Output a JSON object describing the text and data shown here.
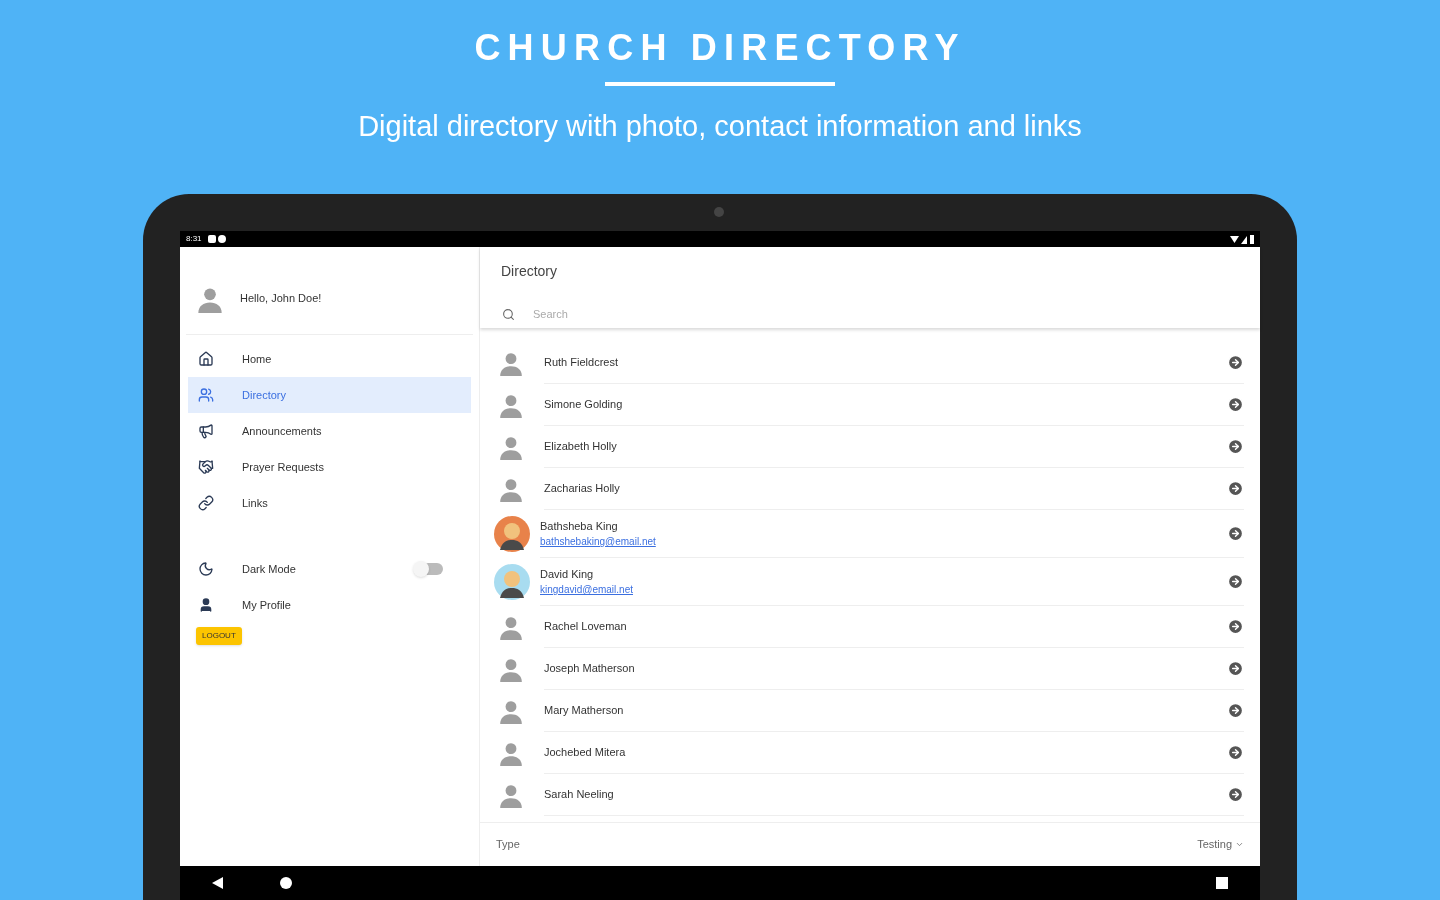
{
  "banner": {
    "title": "CHURCH DIRECTORY",
    "subtitle": "Digital directory with photo, contact information and links"
  },
  "status_bar": {
    "time": "8:31"
  },
  "sidebar": {
    "greeting": "Hello, John Doe!",
    "items": [
      {
        "label": "Home",
        "kind": "home",
        "selected": false
      },
      {
        "label": "Directory",
        "kind": "directory",
        "selected": true
      },
      {
        "label": "Announcements",
        "kind": "announcements",
        "selected": false
      },
      {
        "label": "Prayer Requests",
        "kind": "prayer",
        "selected": false
      },
      {
        "label": "Links",
        "kind": "links",
        "selected": false
      }
    ],
    "dark_mode": {
      "label": "Dark Mode",
      "on": false
    },
    "profile": {
      "label": "My Profile"
    },
    "logout": "LOGOUT"
  },
  "main": {
    "title": "Directory",
    "search": {
      "placeholder": "Search"
    },
    "contacts": [
      {
        "name": "Ruth Fieldcrest",
        "kind": "default"
      },
      {
        "name": "Simone Golding",
        "kind": "default"
      },
      {
        "name": "Elizabeth Holly",
        "kind": "default"
      },
      {
        "name": "Zacharias Holly",
        "kind": "default"
      },
      {
        "name": "Bathsheba King",
        "email": "bathshebaking@email.net",
        "kind": "photo",
        "color": "#e8824a"
      },
      {
        "name": "David King",
        "email": "kingdavid@email.net",
        "kind": "photo",
        "color": "#a8dcf0"
      },
      {
        "name": "Rachel Loveman",
        "kind": "default"
      },
      {
        "name": "Joseph Matherson",
        "kind": "default"
      },
      {
        "name": "Mary Matherson",
        "kind": "default"
      },
      {
        "name": "Jochebed Mitera",
        "kind": "default"
      },
      {
        "name": "Sarah Neeling",
        "kind": "default"
      }
    ],
    "footer": {
      "label": "Type",
      "value": "Testing"
    }
  }
}
